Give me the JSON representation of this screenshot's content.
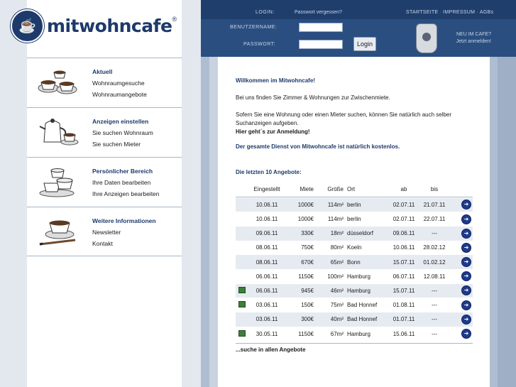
{
  "logo": {
    "text": "mitwohncafe",
    "reg": "®"
  },
  "nav": [
    {
      "title": "Aktuell",
      "links": [
        "Wohnraumgesuche",
        "Wohnraumangebote"
      ],
      "icon": "coffee-cups-icon"
    },
    {
      "title": "Anzeigen einstellen",
      "links": [
        "Sie suchen Wohnraum",
        "Sie suchen Mieter"
      ],
      "icon": "coffee-pot-icon"
    },
    {
      "title": "Persönlicher Bereich",
      "links": [
        "Ihre Daten bearbeiten",
        "Ihre Anzeigen bearbeiten"
      ],
      "icon": "cup-stack-icon"
    },
    {
      "title": "Weitere Informationen",
      "links": [
        "Newsletter",
        "Kontakt"
      ],
      "icon": "cup-pen-icon"
    }
  ],
  "topbar": {
    "login_label": "LOGIN:",
    "forgot": "Passwort vergessen?",
    "menu": [
      "STARTSEITE",
      "IMPRESSUM",
      "AGBs"
    ],
    "username_label": "BENUTZERNAME:",
    "password_label": "PASSWORT:",
    "login_button": "Login",
    "new_line1": "NEU IM CAFE?",
    "new_line2": "Jetzt anmelden!"
  },
  "main": {
    "welcome": "Willkommen im Mitwohncafe!",
    "intro": "Bei uns finden Sie Zimmer & Wohnungen zur Zwischenmiete.",
    "search_info1": "Sofern Sie eine Wohnung oder einen Mieter suchen, können Sie natürlich auch selber",
    "search_info2": "Suchanzeigen aufgeben.",
    "register": "Hier geht´s zur Anmeldung!",
    "free": "Der gesamte Dienst von Mitwohncafe ist natürlich kostenlos.",
    "list_title": "Die letzten 10 Angebote:",
    "more": "...suche in allen Angebote"
  },
  "table": {
    "headers": {
      "eingestellt": "Eingestellt",
      "miete": "Miete",
      "groesse": "Größe",
      "ort": "Ort",
      "ab": "ab",
      "bis": "bis"
    },
    "rows": [
      {
        "photo": false,
        "eingestellt": "10.06.11",
        "miete": "1000€",
        "groesse": "114m²",
        "ort": "berlin",
        "ab": "02.07.11",
        "bis": "21.07.11"
      },
      {
        "photo": false,
        "eingestellt": "10.06.11",
        "miete": "1000€",
        "groesse": "114m²",
        "ort": "berlin",
        "ab": "02.07.11",
        "bis": "22.07.11"
      },
      {
        "photo": false,
        "eingestellt": "09.06.11",
        "miete": "330€",
        "groesse": "18m²",
        "ort": "düsseldorf",
        "ab": "09.06.11",
        "bis": "---"
      },
      {
        "photo": false,
        "eingestellt": "08.06.11",
        "miete": "750€",
        "groesse": "80m²",
        "ort": "Koeln",
        "ab": "10.06.11",
        "bis": "28.02.12"
      },
      {
        "photo": false,
        "eingestellt": "08.06.11",
        "miete": "670€",
        "groesse": "65m²",
        "ort": "Bonn",
        "ab": "15.07.11",
        "bis": "01.02.12"
      },
      {
        "photo": false,
        "eingestellt": "06.06.11",
        "miete": "1150€",
        "groesse": "100m²",
        "ort": "Hamburg",
        "ab": "06.07.11",
        "bis": "12.08.11"
      },
      {
        "photo": true,
        "eingestellt": "06.06.11",
        "miete": "945€",
        "groesse": "46m²",
        "ort": "Hamburg",
        "ab": "15.07.11",
        "bis": "---"
      },
      {
        "photo": true,
        "eingestellt": "03.06.11",
        "miete": "150€",
        "groesse": "75m²",
        "ort": "Bad Honnef",
        "ab": "01.08.11",
        "bis": "---"
      },
      {
        "photo": false,
        "eingestellt": "03.06.11",
        "miete": "300€",
        "groesse": "40m²",
        "ort": "Bad Honnef",
        "ab": "01.07.11",
        "bis": "---"
      },
      {
        "photo": true,
        "eingestellt": "30.05.11",
        "miete": "1150€",
        "groesse": "67m²",
        "ort": "Hamburg",
        "ab": "15.06.11",
        "bis": "---"
      }
    ]
  },
  "colors": {
    "navy": "#1e3a6b",
    "topbar": "#2a4e80",
    "row_alt": "#e6ebf2"
  }
}
